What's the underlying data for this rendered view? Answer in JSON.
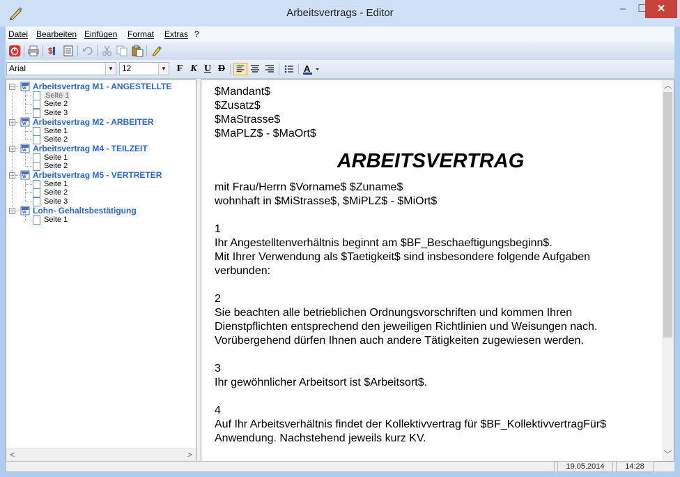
{
  "window": {
    "title": "Arbeitsvertrags - Editor",
    "controls": {
      "minimize": "–",
      "maximize": "☐",
      "close": "✕"
    }
  },
  "menu": [
    "Datei",
    "Bearbeiten",
    "Einfügen",
    "Format",
    "Extras",
    "?"
  ],
  "toolbar": {
    "icons": [
      "exit-icon",
      "print-icon",
      "insert-field-icon",
      "document-properties-icon",
      "undo-icon",
      "cut-icon",
      "copy-icon",
      "paste-icon",
      "clear-format-icon"
    ]
  },
  "format_bar": {
    "font": "Arial",
    "size": "12",
    "bold": "F",
    "italic": "K",
    "underline": "U",
    "strike": "D",
    "align_active": "left",
    "icons": [
      "align-left-icon",
      "align-center-icon",
      "align-right-icon",
      "bullet-list-icon",
      "font-color-icon"
    ],
    "accent_color": "#e3a844"
  },
  "tree": [
    {
      "label": "Arbeitsvertrag M1 - ANGESTELLTE",
      "pages": [
        "Seite 1",
        "Seite 2",
        "Seite 3"
      ]
    },
    {
      "label": "Arbeitsvertrag M2 - ARBEITER",
      "pages": [
        "Seite 1",
        "Seite 2"
      ]
    },
    {
      "label": "Arbeitsvertrag M4 - TEILZEIT",
      "pages": [
        "Seite 1",
        "Seite 2"
      ]
    },
    {
      "label": "Arbeitsvertrag M5 - VERTRETER",
      "pages": [
        "Seite 1",
        "Seite 2",
        "Seite 3"
      ]
    },
    {
      "label": "Lohn- Gehaltsbestätigung",
      "pages": [
        "Seite 1"
      ]
    }
  ],
  "selected_page": "Arbeitsvertrag M1 - ANGESTELLTE / Seite 1",
  "document": {
    "address": [
      "$Mandant$",
      "$Zusatz$",
      "$MaStrasse$",
      "$MaPLZ$ - $MaOrt$"
    ],
    "heading": "ARBEITSVERTRAG",
    "intro": [
      "mit Frau/Herrn $Vorname$ $Zuname$",
      "wohnhaft in $MiStrasse$, $MiPLZ$ - $MiOrt$"
    ],
    "sections": [
      {
        "number": "1",
        "lines": [
          "Ihr Angestelltenverhältnis beginnt am $BF_Beschaeftigungsbeginn$.",
          "Mit Ihrer Verwendung als $Taetigkeit$ sind insbesondere folgende Aufgaben",
          "verbunden:"
        ]
      },
      {
        "number": "2",
        "lines": [
          "Sie beachten alle betrieblichen Ordnungsvorschriften und kommen Ihren",
          "Dienstpflichten entsprechend den jeweiligen Richtlinien und Weisungen nach.",
          "Vorübergehend dürfen Ihnen auch andere Tätigkeiten zugewiesen werden."
        ]
      },
      {
        "number": "3",
        "lines": [
          "Ihr gewöhnlicher Arbeitsort ist $Arbeitsort$."
        ]
      },
      {
        "number": "4",
        "lines": [
          "Auf Ihr Arbeitsverhältnis findet der Kollektivvertrag für $BF_KollektivvertragFür$",
          "Anwendung. Nachstehend jeweils kurz KV."
        ]
      }
    ]
  },
  "status": {
    "date": "19.05.2014",
    "time": "14:28"
  },
  "colors": {
    "tree_node": "#2a67c8",
    "title_bar": "#cde0f5",
    "close_button": "#c7423a"
  }
}
